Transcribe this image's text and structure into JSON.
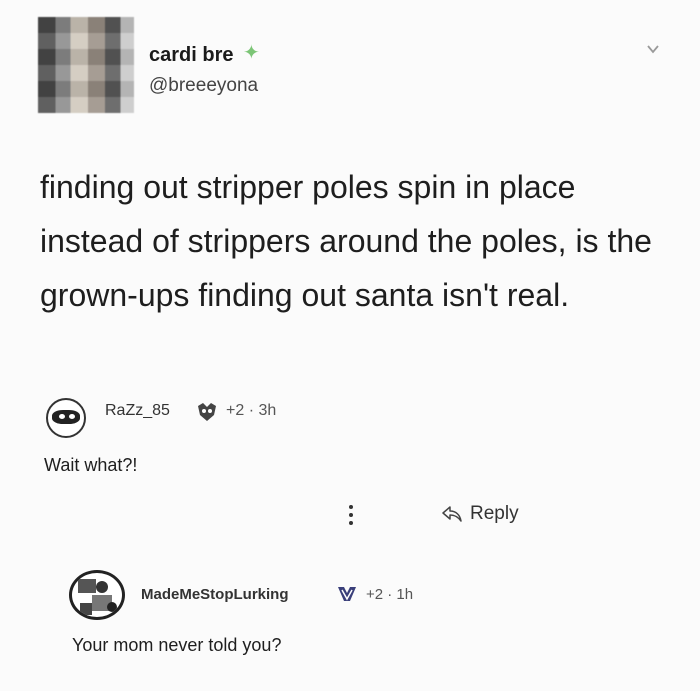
{
  "post": {
    "author_name": "cardi bre",
    "author_handle": "@breeeyona",
    "sparkle_icon": "sparkle-icon",
    "text": "finding out stripper poles spin in place instead of strippers around the poles, is the grown-ups finding out santa isn't real."
  },
  "comments": [
    {
      "username": "RaZz_85",
      "meta": "+2 · 3h",
      "text": "Wait what?!",
      "actions": {
        "reply_label": "Reply"
      }
    },
    {
      "username": "MadeMeStopLurking",
      "meta": "+2 · 1h",
      "text": "Your mom never told you?"
    }
  ],
  "colors": {
    "sparkle": "#7cc576",
    "background": "#fbfbfb"
  }
}
